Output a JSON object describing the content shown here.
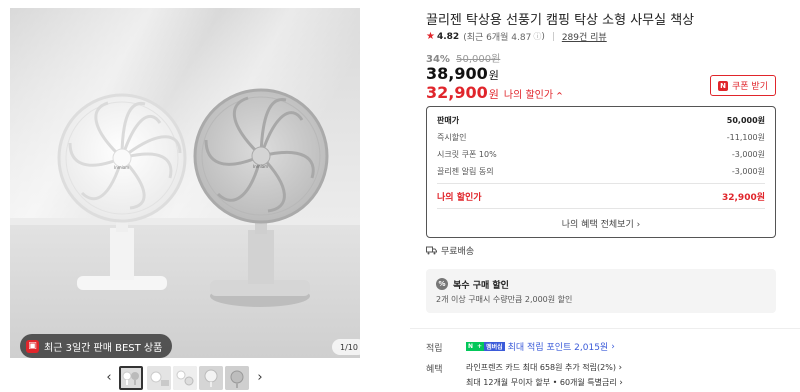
{
  "gallery": {
    "badge_icon": "tag-icon",
    "badge_text": "최근 3일간 판매 BEST 상품",
    "counter": "1/10",
    "fan_brand": "Inmiam",
    "thumbnail_count": 5,
    "selected_thumbnail": 1
  },
  "product": {
    "title": "끌리젠 탁상용 선풍기 캠핑 탁상 소형 사무실 책상",
    "rating": "4.82",
    "rating_recent": "(최근 6개월 4.87",
    "reviews": "289건 리뷰",
    "discount_pct": "34%",
    "original_price": "50,000원",
    "price": "38,900",
    "price_unit": "원",
    "my_price": "32,900",
    "my_price_unit": "원",
    "my_price_label": "나의 할인가",
    "coupon_button": "쿠폰 받기"
  },
  "breakdown": {
    "rows": [
      {
        "label": "판매가",
        "value": "50,000원"
      },
      {
        "label": "즉시할인",
        "value": "-11,100원"
      },
      {
        "label": "시크릿 쿠폰 10%",
        "value": "-3,000원"
      },
      {
        "label": "끌리젠 알림 동의",
        "value": "-3,000원"
      }
    ],
    "total_label": "나의 할인가",
    "total_value": "32,900원",
    "view_all": "나의 혜택 전체보기"
  },
  "shipping": "무료배송",
  "multi_discount": {
    "title": "복수 구매 할인",
    "desc": "2개 이상 구매시 수량만큼 2,000원 할인"
  },
  "points": {
    "label": "적립",
    "badge_n": "N",
    "badge_plus": "+",
    "badge_member": "멤버십",
    "text": "최대 적립 포인트 2,015원"
  },
  "benefits": {
    "label": "혜택",
    "line1": "라인프렌즈 카드 최대 658원 추가 적립(2%)",
    "line2": "최대 12개월 무이자 할부 • 60개월 특별금리"
  },
  "colors": {
    "accent_red": "#e0252b",
    "point_blue": "#3b5bd9"
  }
}
